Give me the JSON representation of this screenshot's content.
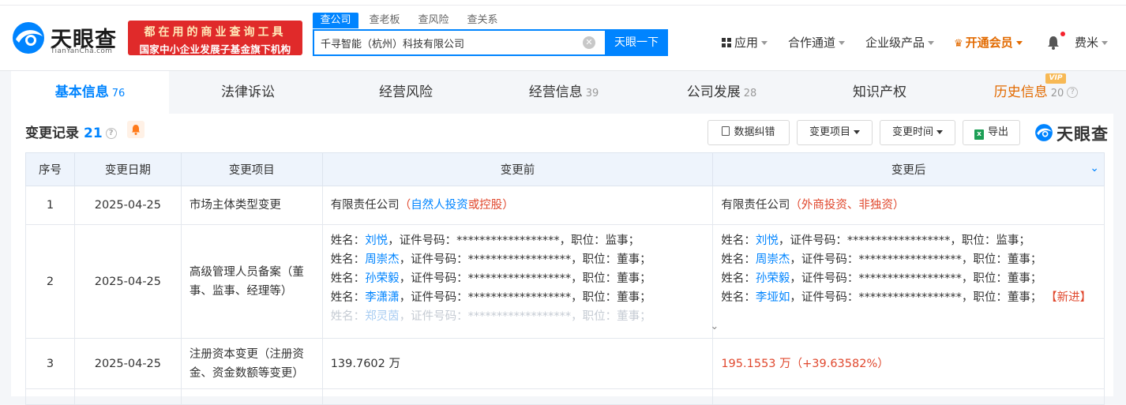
{
  "brand": {
    "name": "天眼查",
    "domain": "TianYanCha.com",
    "promo_line1": "都在用的商业查询工具",
    "promo_line2": "国家中小企业发展子基金旗下机构"
  },
  "search": {
    "tabs": [
      "查公司",
      "查老板",
      "查风险",
      "查关系"
    ],
    "active_tab": 0,
    "value": "千寻智能（杭州）科技有限公司",
    "button": "天眼一下"
  },
  "nav": {
    "apps": "应用",
    "channel": "合作通道",
    "enterprise": "企业级产品",
    "vip": "开通会员",
    "user": "费米"
  },
  "main_tabs": [
    {
      "label": "基本信息",
      "count": "76"
    },
    {
      "label": "法律诉讼",
      "count": ""
    },
    {
      "label": "经营风险",
      "count": ""
    },
    {
      "label": "经营信息",
      "count": "39"
    },
    {
      "label": "公司发展",
      "count": "28"
    },
    {
      "label": "知识产权",
      "count": ""
    },
    {
      "label": "历史信息",
      "count": "20"
    }
  ],
  "vip_badge": "VIP",
  "section": {
    "title": "变更记录",
    "count": "21",
    "buttons": {
      "correct": "数据纠错",
      "item": "变更项目",
      "time": "变更时间",
      "export": "导出"
    },
    "watermark": "天眼查"
  },
  "table": {
    "headers": [
      "序号",
      "变更日期",
      "变更项目",
      "变更前",
      "变更后"
    ],
    "rows": [
      {
        "no": "1",
        "date": "2025-04-25",
        "item": "市场主体类型变更",
        "before": {
          "main": "有限责任公司",
          "open": "（",
          "link": "自然人投资",
          "rest": "或控股",
          "close": "）"
        },
        "after": {
          "main": "有限责任公司",
          "note": "（外商投资、非独资）"
        }
      },
      {
        "no": "2",
        "date": "2025-04-25",
        "item": "高级管理人员备案（董事、监事、经理等）",
        "before": [
          {
            "pre": "姓名：",
            "name": "刘悦",
            "post": "，证件号码：******************，职位：监事；"
          },
          {
            "pre": "姓名：",
            "name": "周崇杰",
            "post": "，证件号码：******************，职位：董事；"
          },
          {
            "pre": "姓名：",
            "name": "孙荣毅",
            "post": "，证件号码：******************，职位：董事；"
          },
          {
            "pre": "姓名：",
            "name": "李潇潇",
            "post": "，证件号码：******************，职位：董事；"
          },
          {
            "pre": "姓名：",
            "name": "郑灵茵",
            "post": "，证件号码：******************，职位：董事；"
          }
        ],
        "after": [
          {
            "pre": "姓名：",
            "name": "刘悦",
            "post": "，证件号码：******************，职位：监事；",
            "tag": ""
          },
          {
            "pre": "姓名：",
            "name": "周崇杰",
            "post": "，证件号码：******************，职位：董事；",
            "tag": ""
          },
          {
            "pre": "姓名：",
            "name": "孙荣毅",
            "post": "，证件号码：******************，职位：董事；",
            "tag": ""
          },
          {
            "pre": "姓名：",
            "name": "李垭如",
            "post": "，证件号码：******************，职位：董事；",
            "tag": "【新进】"
          }
        ]
      },
      {
        "no": "3",
        "date": "2025-04-25",
        "item": "注册资本变更（注册资金、资金数额等变更）",
        "before": "139.7602 万",
        "after": "195.1553 万（+39.63582%）"
      }
    ]
  }
}
